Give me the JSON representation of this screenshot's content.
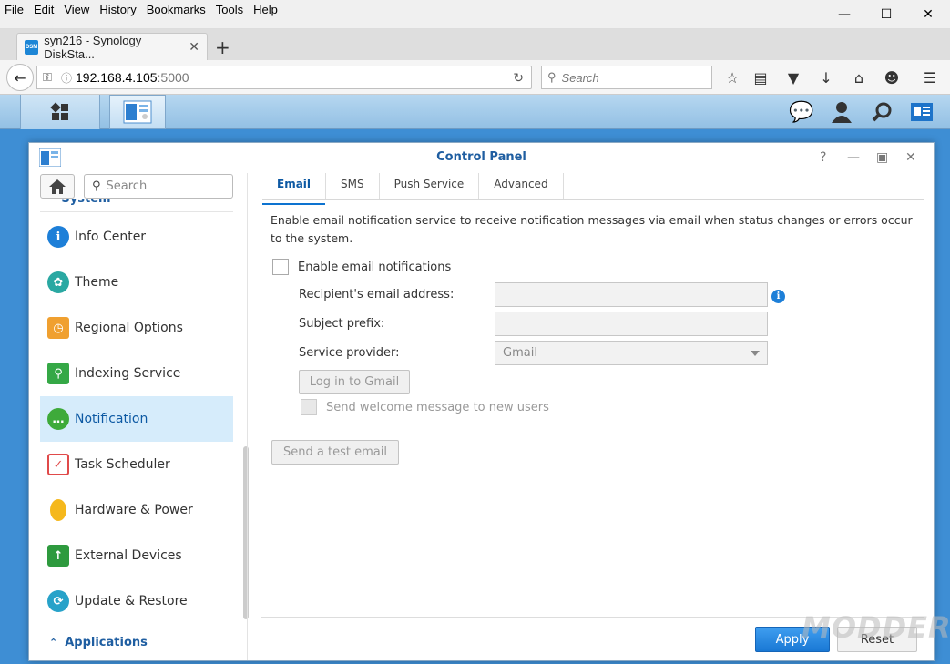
{
  "browser": {
    "menu": [
      "File",
      "Edit",
      "View",
      "History",
      "Bookmarks",
      "Tools",
      "Help"
    ],
    "tab_title": "syn216 - Synology DiskSta...",
    "favicon_text": "DSM",
    "url_host": "192.168.4.105",
    "url_port": ":5000",
    "search_placeholder": "Search"
  },
  "window": {
    "title": "Control Panel"
  },
  "sidebar": {
    "search_placeholder": "Search",
    "section_system": "System",
    "items": [
      {
        "label": "Info Center",
        "icon": "info-icon",
        "color": "#1d7fd8",
        "glyph": "i"
      },
      {
        "label": "Theme",
        "icon": "palette-icon",
        "color": "#2aa8a2",
        "glyph": "✿"
      },
      {
        "label": "Regional Options",
        "icon": "map-clock-icon",
        "color": "#f0a030",
        "glyph": "◷"
      },
      {
        "label": "Indexing Service",
        "icon": "magnifier-doc-icon",
        "color": "#35a846",
        "glyph": "⚲"
      },
      {
        "label": "Notification",
        "icon": "chat-bubble-icon",
        "color": "#3eaa3a",
        "glyph": "…"
      },
      {
        "label": "Task Scheduler",
        "icon": "calendar-check-icon",
        "color": "#e04a4a",
        "glyph": "✓"
      },
      {
        "label": "Hardware & Power",
        "icon": "lightbulb-icon",
        "color": "#f5b81c",
        "glyph": "●"
      },
      {
        "label": "External Devices",
        "icon": "upload-box-icon",
        "color": "#2e9a3e",
        "glyph": "↑"
      },
      {
        "label": "Update & Restore",
        "icon": "refresh-icon",
        "color": "#27a2c9",
        "glyph": "⟳"
      }
    ],
    "section_applications": "Applications"
  },
  "tabs": [
    {
      "label": "Email",
      "active": true
    },
    {
      "label": "SMS",
      "active": false
    },
    {
      "label": "Push Service",
      "active": false
    },
    {
      "label": "Advanced",
      "active": false
    }
  ],
  "email": {
    "description": "Enable email notification service to receive notification messages via email when status changes or errors occur to the system.",
    "enable_label": "Enable email notifications",
    "recipient_label": "Recipient's email address:",
    "subject_label": "Subject prefix:",
    "provider_label": "Service provider:",
    "provider_value": "Gmail",
    "login_button": "Log in to Gmail",
    "welcome_label": "Send welcome message to new users",
    "test_button": "Send a test email"
  },
  "footer": {
    "apply": "Apply",
    "reset": "Reset"
  },
  "watermark": "MODDERS"
}
